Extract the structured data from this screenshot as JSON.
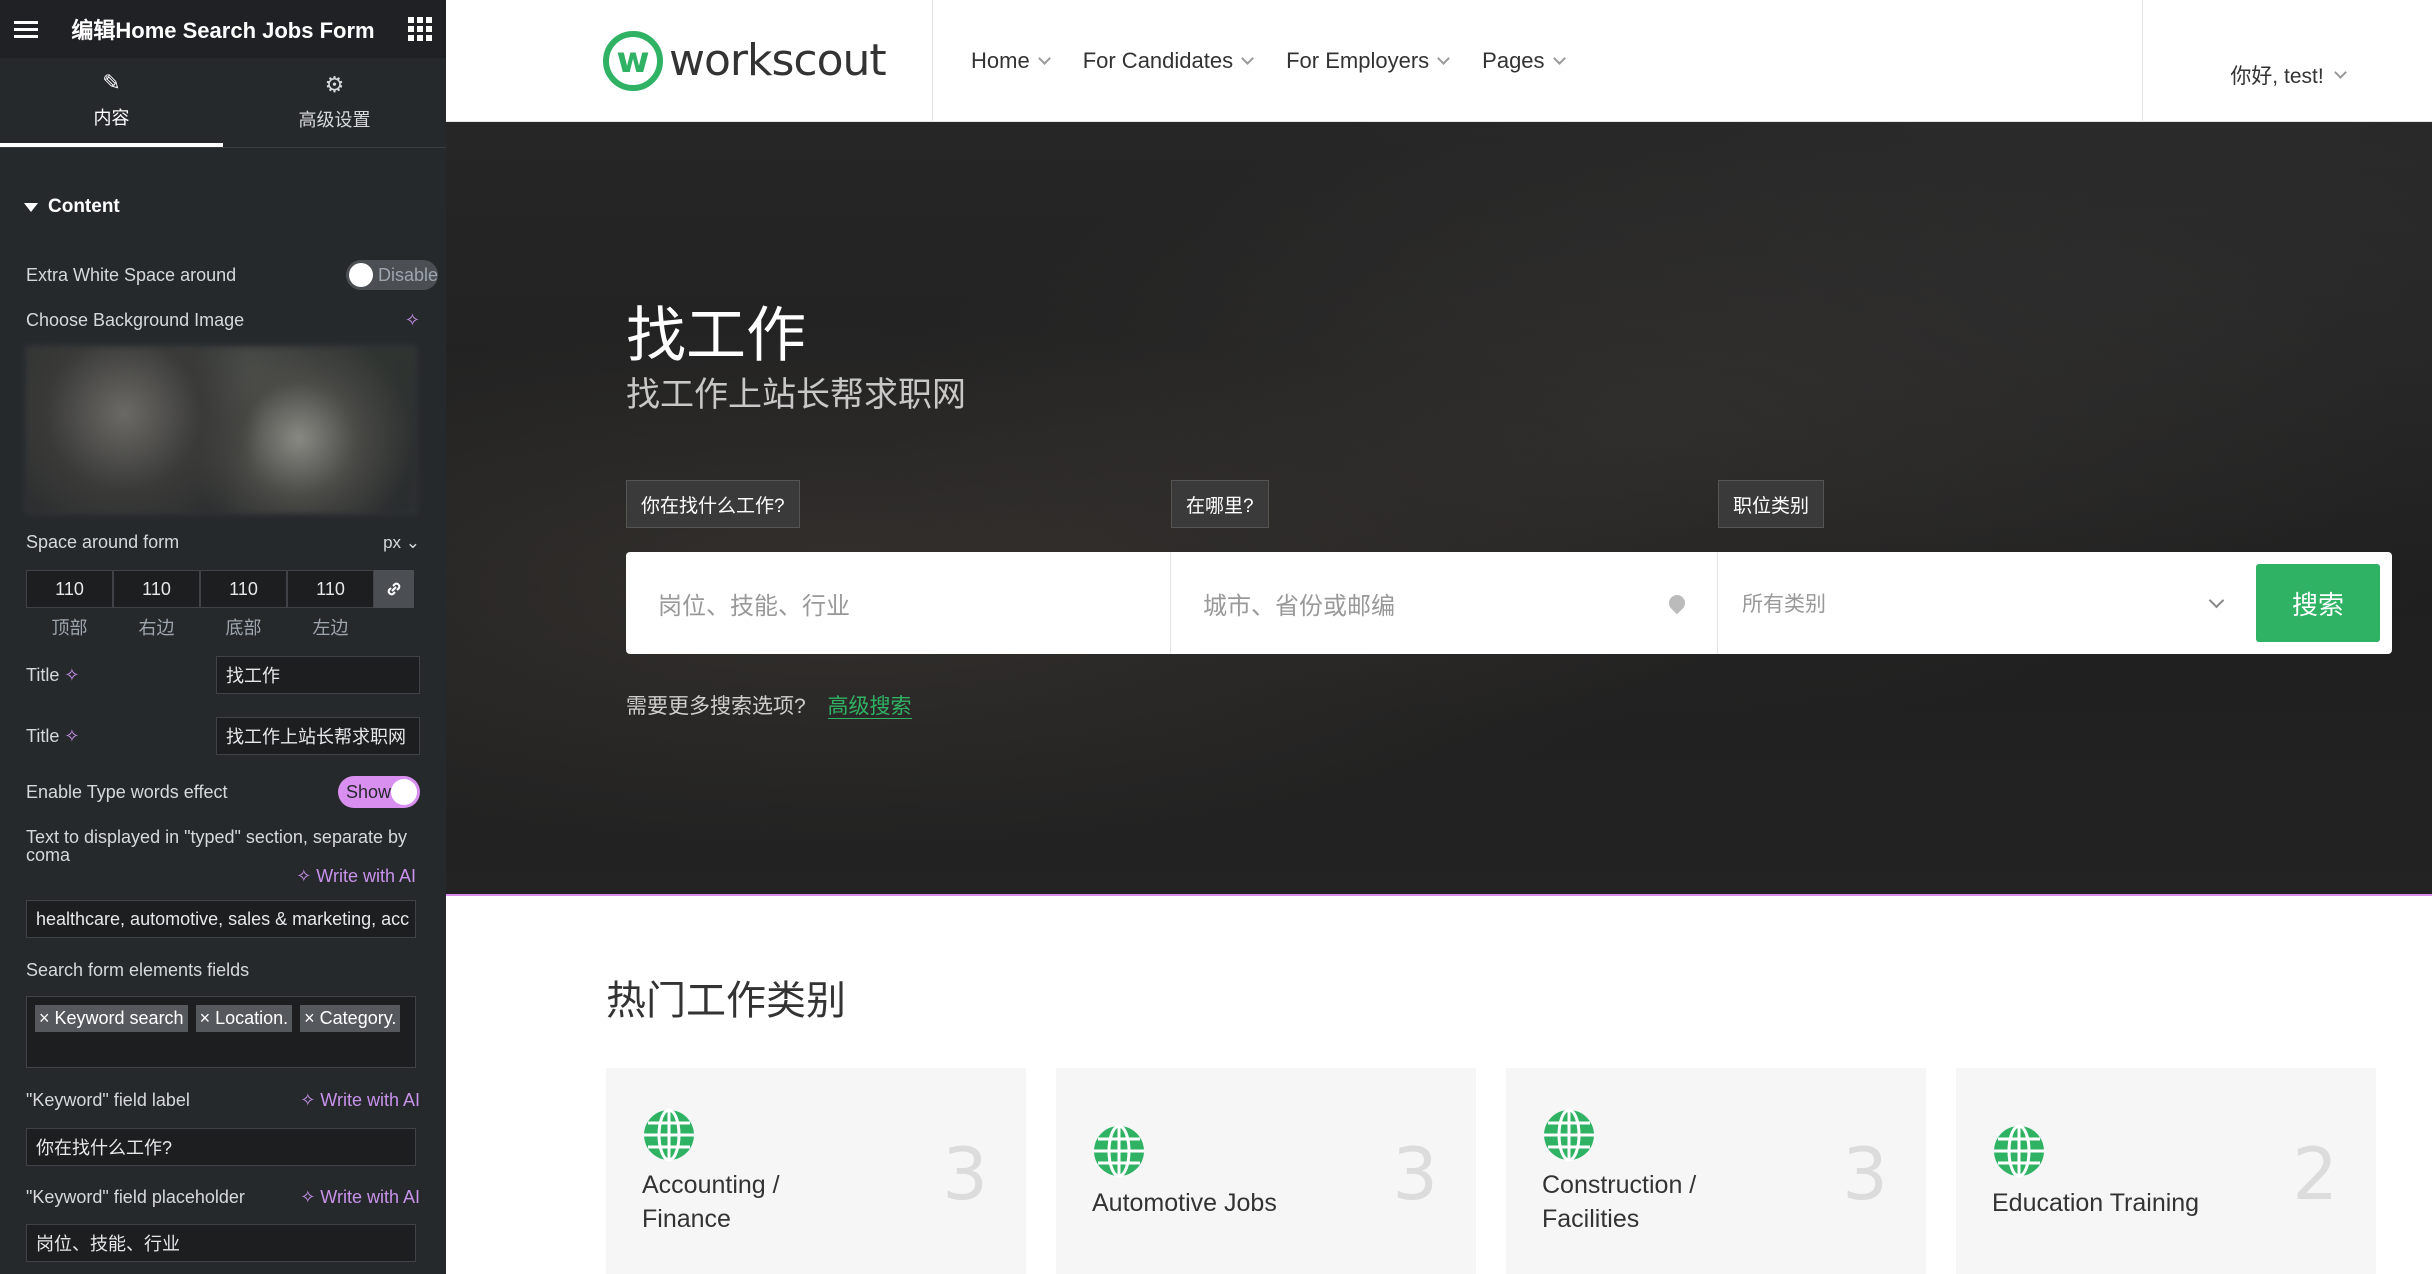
{
  "panel": {
    "title": "编辑Home Search Jobs Form",
    "tabs": [
      {
        "label": "内容",
        "icon": "pencil-icon"
      },
      {
        "label": "高级设置",
        "icon": "gear-icon"
      }
    ],
    "section": "Content",
    "extra_space": {
      "label": "Extra White Space around",
      "toggle": "Disable"
    },
    "bg_image_label": "Choose Background Image",
    "space_around": {
      "label": "Space around form",
      "unit": "px",
      "values": [
        "110",
        "110",
        "110",
        "110"
      ],
      "sides": [
        "顶部",
        "右边",
        "底部",
        "左边"
      ]
    },
    "title1": {
      "label": "Title",
      "value": "找工作"
    },
    "title2": {
      "label": "Title",
      "value": "找工作上站长帮求职网"
    },
    "type_effect": {
      "label": "Enable Type words effect",
      "toggle": "Show"
    },
    "typed_text": {
      "label": "Text to displayed in \"typed\" section, separate by coma",
      "ai": "Write with AI",
      "value": "healthcare, automotive, sales & marketing, acc"
    },
    "fields": {
      "label": "Search form elements fields",
      "tags": [
        "× Keyword search",
        "× Location.",
        "× Category."
      ]
    },
    "kw_label": {
      "label": "\"Keyword\" field label",
      "ai": "Write with AI",
      "value": "你在找什么工作?"
    },
    "kw_placeholder": {
      "label": "\"Keyword\" field placeholder",
      "ai": "Write with AI",
      "value": "岗位、技能、行业"
    }
  },
  "site": {
    "logo": "workscout",
    "logo_letter": "w",
    "nav": [
      "Home",
      "For Candidates",
      "For Employers",
      "Pages"
    ],
    "user": "你好, test!",
    "hero": {
      "title": "找工作",
      "subtitle": "找工作上站长帮求职网",
      "labels": [
        "你在找什么工作?",
        "在哪里?",
        "职位类别"
      ],
      "kw_placeholder": "岗位、技能、行业",
      "loc_placeholder": "城市、省份或邮编",
      "cat_placeholder": "所有类别",
      "search_button": "搜索",
      "adv_text": "需要更多搜索选项?",
      "adv_link": "高级搜索"
    },
    "categories_title": "热门工作类别",
    "categories": [
      {
        "name": "Accounting / Finance",
        "count": "3"
      },
      {
        "name": "Automotive Jobs",
        "count": "3"
      },
      {
        "name": "Construction / Facilities",
        "count": "3"
      },
      {
        "name": "Education Training",
        "count": "2"
      }
    ],
    "accent": "#2fb264"
  }
}
